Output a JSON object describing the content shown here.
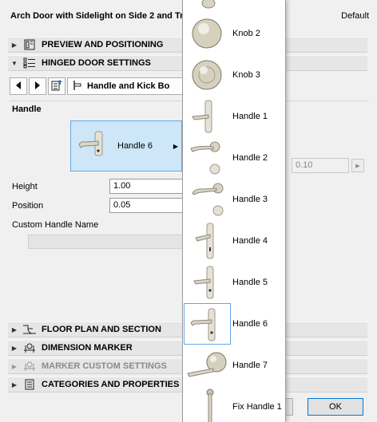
{
  "dialog": {
    "title": "Arch Door with Sidelight on Side 2 and Tr",
    "default_label": "Default"
  },
  "sections": {
    "preview": "PREVIEW AND POSITIONING",
    "hinged": "HINGED DOOR SETTINGS",
    "floor_plan": "FLOOR PLAN AND SECTION",
    "dimension": "DIMENSION MARKER",
    "marker_custom": "MARKER CUSTOM SETTINGS",
    "categories": "CATEGORIES AND PROPERTIES"
  },
  "nav": {
    "page_label": "Handle and Kick Bo"
  },
  "handle": {
    "heading": "Handle",
    "selected_name": "Handle 6",
    "height_label": "Height",
    "height_value": "1.00",
    "position_label": "Position",
    "position_value": "0.05",
    "custom_name_label": "Custom Handle Name",
    "custom_name_value": ""
  },
  "offset_value": "0.10",
  "buttons": {
    "ok": "OK"
  },
  "popup_items": [
    {
      "label": "Knob 2",
      "icon": "knob-icon"
    },
    {
      "label": "Knob 3",
      "icon": "knob-icon"
    },
    {
      "label": "Handle 1",
      "icon": "handle-plate-icon"
    },
    {
      "label": "Handle 2",
      "icon": "handle-rose-icon"
    },
    {
      "label": "Handle 3",
      "icon": "handle-rose-icon"
    },
    {
      "label": "Handle 4",
      "icon": "handle-plate-icon"
    },
    {
      "label": "Handle 5",
      "icon": "handle-plate-icon"
    },
    {
      "label": "Handle 6",
      "icon": "handle-plate-icon",
      "selected": true
    },
    {
      "label": "Handle 7",
      "icon": "knob-lever-icon"
    },
    {
      "label": "Fix Handle 1",
      "icon": "fix-handle-icon"
    }
  ],
  "colors": {
    "selection_bg": "#cde6f8",
    "selection_border": "#66a7e8",
    "ok_border": "#0078d7"
  }
}
